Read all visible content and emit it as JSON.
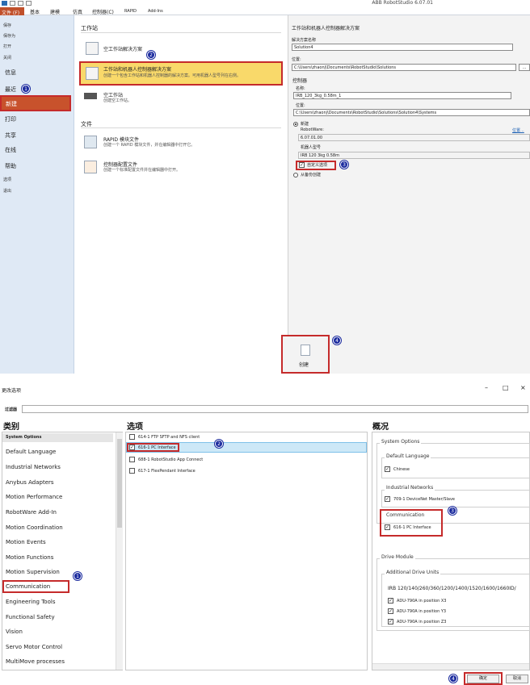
{
  "top": {
    "app_title": "ABB RobotStudio 6.07.01",
    "ribbon_tabs": [
      "文件 (F)",
      "基本",
      "建模",
      "仿真",
      "控制器(C)",
      "RAPID",
      "Add-Ins"
    ],
    "nav": {
      "small_items": [
        "保存",
        "保存为",
        "打开",
        "关闭"
      ],
      "info": "信息",
      "recent": "最近",
      "new": "新建",
      "print": "打印",
      "share": "共享",
      "online": "在线",
      "help": "帮助",
      "options": "选项",
      "exit": "退出"
    },
    "workstation": {
      "header": "工作站",
      "empty_solution": "空工作站解决方案",
      "with_controller_title": "工作站和机器人控制器解决方案",
      "with_controller_desc": "创建一个包含工作站和机器人控制器的解决方案。可用机器人型号列在右侧。",
      "empty_station_title": "空工作站",
      "empty_station_desc": "创建空工作站。"
    },
    "files": {
      "header": "文件",
      "rapid_title": "RAPID 模块文件",
      "rapid_desc": "创建一个 RAPID 模块文件，并在编辑器中打开它。",
      "cfg_title": "控制器配置文件",
      "cfg_desc": "创建一个标准配置文件并在编辑器中打开。"
    },
    "form": {
      "title": "工作站和机器人控制器解决方案",
      "solution_name_label": "解决方案名称",
      "solution_name_value": "Solution4",
      "location_label": "位置:",
      "location_value": "C:\\Users\\zhaonj\\Documents\\RobotStudio\\Solutions",
      "browse": "...",
      "controller_label": "控制器",
      "name_label": "名称:",
      "name_value": "IRB_120_3kg_0.58m_1",
      "ctrl_location_label": "位置:",
      "ctrl_location_value": "C:\\Users\\zhaonj\\Documents\\RobotStudio\\Solutions\\Solution4\\Systems",
      "new_radio": "新建",
      "robotware_label": "RobotWare:",
      "robotware_link": "位置...",
      "robotware_value": "6.07.01.00",
      "model_label": "机器人型号",
      "model_value": "IRB 120 3kg 0.58m",
      "custom_options": "自定义选项",
      "from_backup": "从备份创建",
      "create": "创建"
    },
    "badges": [
      "1",
      "2",
      "3",
      "4"
    ]
  },
  "bottom": {
    "window_title": "更改选项",
    "filter_label": "过滤器",
    "headers": {
      "category": "类别",
      "options": "选项",
      "overview": "概况"
    },
    "categories": [
      "System Options",
      "Default Language",
      "Industrial Networks",
      "Anybus Adapters",
      "Motion Performance",
      "RobotWare Add-In",
      "Motion Coordination",
      "Motion Events",
      "Motion Functions",
      "Motion Supervision",
      "Communication",
      "Engineering Tools",
      "Functional Safety",
      "Vision",
      "Servo Motor Control",
      "MultiMove processes"
    ],
    "options": [
      {
        "label": "614-1 FTP SFTP and NFS client",
        "checked": false
      },
      {
        "label": "616-1 PC Interface",
        "checked": true
      },
      {
        "label": "688-1 RobotStudio App Connect",
        "checked": false
      },
      {
        "label": "617-1 FlexPendant Interface",
        "checked": false
      }
    ],
    "overview": {
      "system_options": "System Options",
      "default_language": "Default Language",
      "chinese": "Chinese",
      "industrial_networks": "Industrial Networks",
      "devicenet": "709-1 DeviceNet Master/Slave",
      "communication": "Communication",
      "pc_interface": "616-1 PC Interface",
      "drive_module": "Drive Module",
      "additional_drive_units": "Additional Drive Units",
      "irb": "IRB 120/140/260/360/1200/1400/1520/1600/1660ID/",
      "adu": [
        "ADU-790A in position X3",
        "ADU-790A in position Y3",
        "ADU-790A in position Z3"
      ]
    },
    "ok": "确定",
    "cancel": "取消",
    "badges": [
      "1",
      "2",
      "3",
      "4"
    ]
  }
}
